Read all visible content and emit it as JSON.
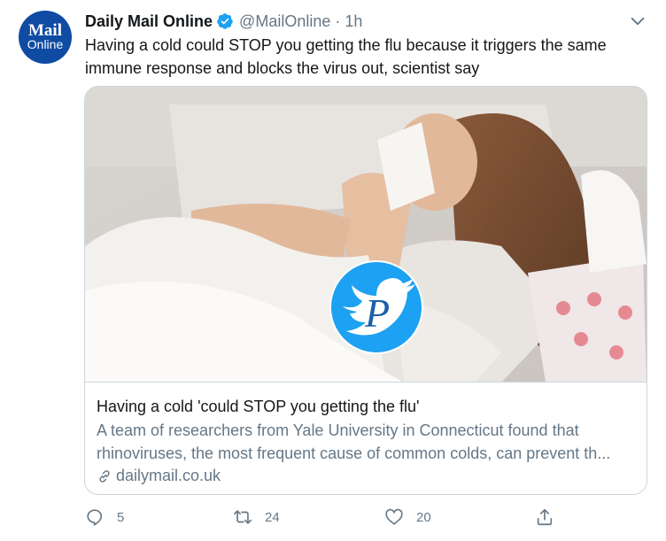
{
  "tweet": {
    "avatar": {
      "line1": "Mail",
      "line2": "Online"
    },
    "display_name": "Daily Mail Online",
    "handle": "@MailOnline",
    "separator": "·",
    "time": "1h",
    "text": "Having a cold could STOP you getting the flu because it triggers the same immune response and blocks the virus out, scientist say"
  },
  "card": {
    "title": "Having a cold 'could STOP you getting the flu'",
    "description_lines": [
      "A team of researchers from Yale University in Connecticut found that",
      "rhinoviruses, the most frequent cause of common colds, can prevent th..."
    ],
    "domain": "dailymail.co.uk",
    "overlay_letter": "P"
  },
  "actions": {
    "reply_count": "5",
    "retweet_count": "24",
    "like_count": "20"
  },
  "colors": {
    "avatar_bg": "#0f4ba3",
    "verified": "#1da1f2",
    "secondary_text": "#657786",
    "border": "#ccd6dd",
    "logo_overlay": "#1da1f2"
  }
}
